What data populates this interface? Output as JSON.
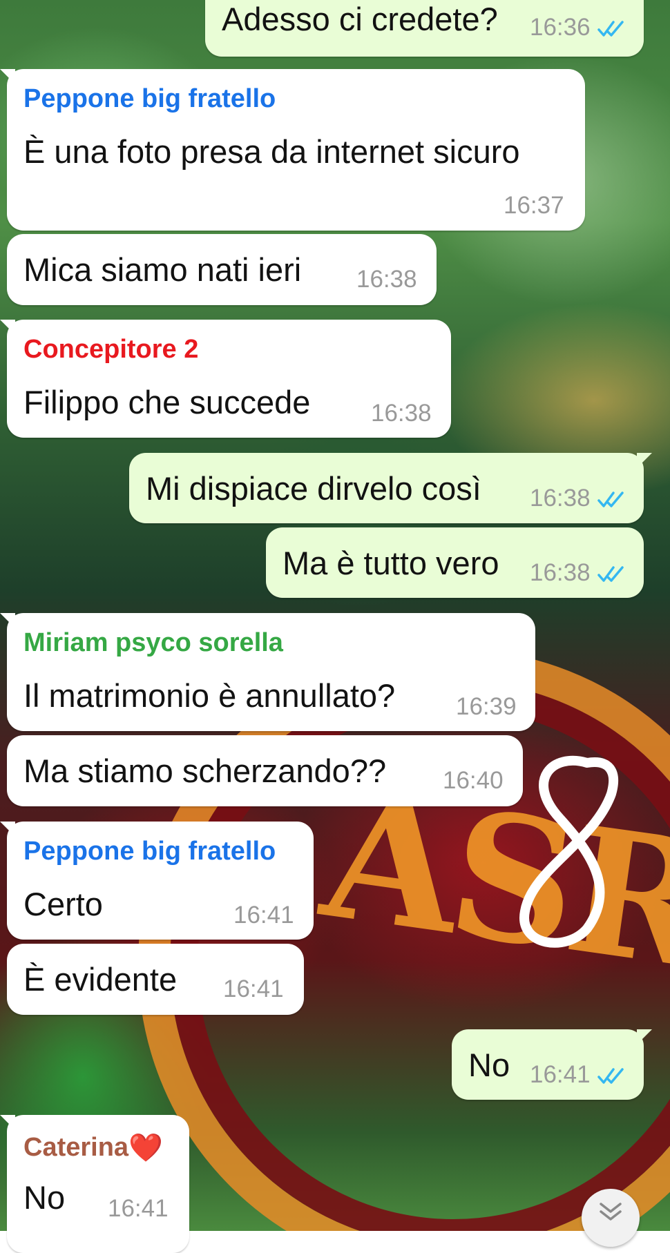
{
  "messages": [
    {
      "direction": "out",
      "text": "Adesso ci credete?",
      "time": "16:36",
      "status": "read"
    },
    {
      "direction": "in",
      "sender": "Peppone big fratello",
      "text": "È una foto presa da internet sicuro",
      "time": "16:37"
    },
    {
      "direction": "in",
      "text": "Mica siamo nati ieri",
      "time": "16:38"
    },
    {
      "direction": "in",
      "sender": "Concepitore 2",
      "text": "Filippo che succede",
      "time": "16:38"
    },
    {
      "direction": "out",
      "text": "Mi dispiace dirvelo così",
      "time": "16:38",
      "status": "read"
    },
    {
      "direction": "out",
      "text": "Ma è tutto vero",
      "time": "16:38",
      "status": "read"
    },
    {
      "direction": "in",
      "sender": "Miriam psyco sorella",
      "text": "Il matrimonio è annullato?",
      "time": "16:39"
    },
    {
      "direction": "in",
      "text": "Ma stiamo scherzando??",
      "time": "16:40"
    },
    {
      "direction": "in",
      "sender": "Peppone big fratello",
      "text": "Certo",
      "time": "16:41"
    },
    {
      "direction": "in",
      "text": "È evidente",
      "time": "16:41"
    },
    {
      "direction": "out",
      "text": "No",
      "time": "16:41",
      "status": "read"
    },
    {
      "direction": "in",
      "sender": "Caterina",
      "sender_emoji": "❤️",
      "text": "No",
      "time": "16:41"
    }
  ],
  "wallpaper": {
    "flag_text": "ASR",
    "drawn_mark": "8"
  },
  "icons": {
    "read_receipt": "double-check-icon",
    "scroll": "chevron-double-down-icon",
    "sender_emoji": "heart-icon"
  },
  "colors": {
    "incoming_bubble": "#ffffff",
    "outgoing_bubble": "#e9fdd6",
    "timestamp": "#999999",
    "read_tick": "#34b7f1",
    "sender_peppone": "#1a73e8",
    "sender_concepitore": "#e8191f",
    "sender_miriam": "#35a844",
    "sender_caterina": "#a85c44"
  }
}
